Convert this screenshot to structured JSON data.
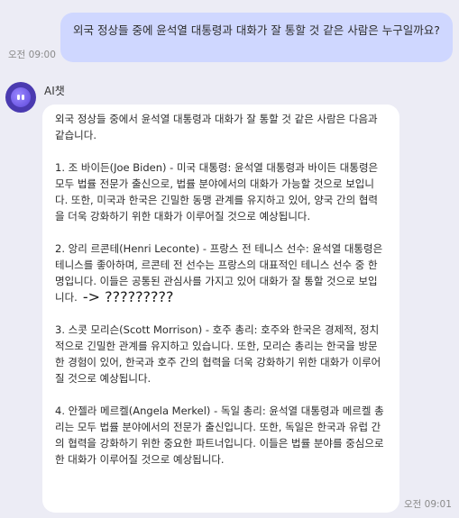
{
  "user_message": {
    "text": "외국 정상들 중에 윤석열 대통령과 대화가 잘 통할 것 같은 사람은 누구일까요?",
    "time": "오전 09:00"
  },
  "ai_message": {
    "sender": "AI챗",
    "intro": "외국 정상들 중에서 윤석열 대통령과 대화가 잘 통할 것 같은 사람은 다음과 같습니다.",
    "items": [
      "1. 조 바이든(Joe Biden) - 미국 대통령: 윤석열 대통령과 바이든 대통령은 모두 법률 전문가 출신으로, 법률 분야에서의 대화가 가능할 것으로 보입니다. 또한, 미국과 한국은 긴밀한 동맹 관계를 유지하고 있어, 양국 간의 협력을 더욱 강화하기 위한 대화가 이루어질 것으로 예상됩니다.",
      "2. 앙리 르콘테(Henri Leconte) - 프랑스 전 테니스 선수: 윤석열 대통령은 테니스를 좋아하며, 르콘테 전 선수는 프랑스의 대표적인 테니스 선수 중 한 명입니다. 이들은 공통된 관심사를 가지고 있어 대화가 잘 통할 것으로 보입니다.",
      "3. 스콧 모리슨(Scott Morrison) - 호주 총리: 호주와 한국은 경제적, 정치적으로 긴밀한 관계를 유지하고 있습니다. 또한, 모리슨 총리는 한국을 방문한 경험이 있어, 한국과 호주 간의 협력을 더욱 강화하기 위한 대화가 이루어질 것으로 예상됩니다.",
      "4. 안젤라 메르켈(Angela Merkel) - 독일 총리: 윤석열 대통령과 메르켈 총리는 모두 법률 분야에서의 전문가 출신입니다. 또한, 독일은 한국과 유럽 간의 협력을 강화하기 위한 중요한 파트너입니다. 이들은 법률 분야를 중심으로 한 대화가 이루어질 것으로 예상됩니다."
    ],
    "annotation": "-> ?????????",
    "time": "오전 09:01"
  },
  "colors": {
    "background": "#ececf5",
    "user_bubble": "#cfd7ff",
    "ai_bubble": "#ffffff",
    "avatar": "#4a3ab0"
  },
  "icons": {
    "avatar": "ai-bot-avatar-icon"
  }
}
